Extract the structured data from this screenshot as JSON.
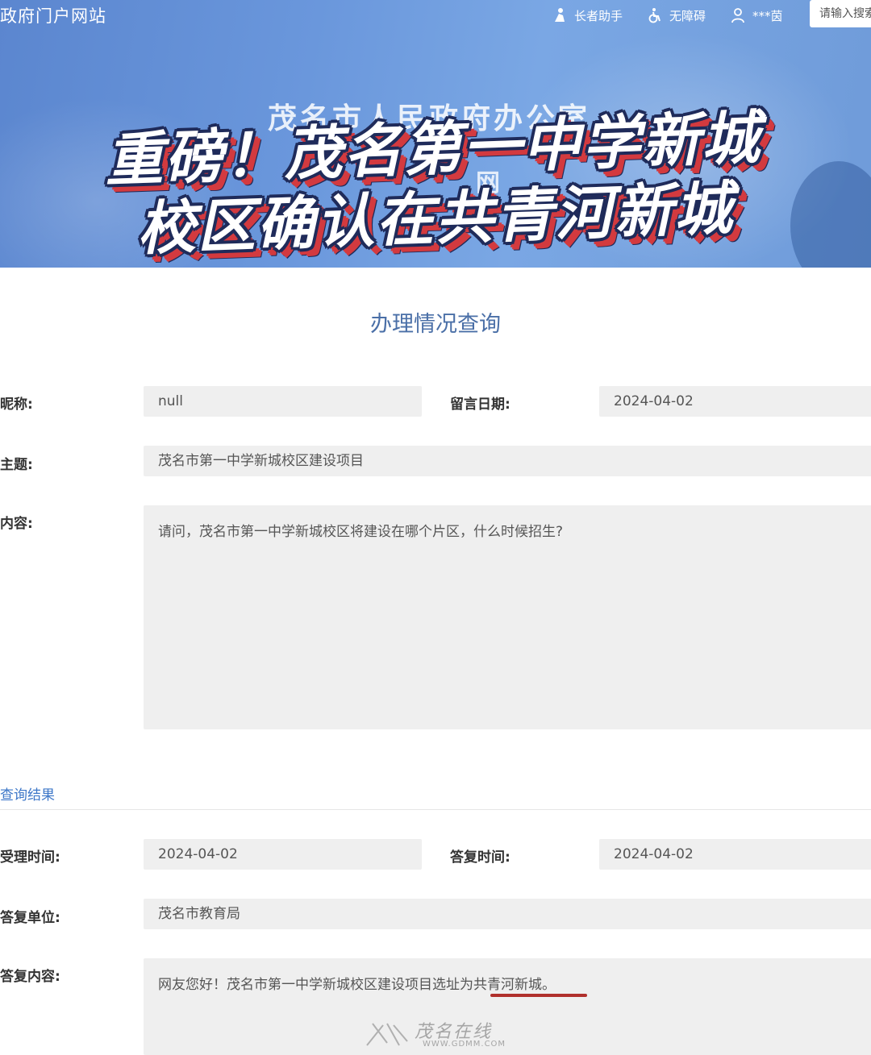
{
  "header": {
    "site_name": "政府门户网站",
    "nav": [
      {
        "label": "长者助手",
        "icon": "elder-assist-icon"
      },
      {
        "label": "无障碍",
        "icon": "accessibility-icon"
      },
      {
        "label": "***茵",
        "icon": "user-icon"
      }
    ],
    "search_placeholder": "请输入搜索",
    "org_title": "茂名市人民政府办公室",
    "org_subtitle": "网"
  },
  "headline": {
    "line1": "重磅！茂名第一中学新城",
    "line2": "校区确认在共青河新城"
  },
  "page_title": "办理情况查询",
  "form": {
    "nickname_label": "昵称:",
    "nickname_value": "null",
    "date_label": "留言日期:",
    "date_value": "2024-04-02",
    "subject_label": "主题:",
    "subject_value": "茂名市第一中学新城校区建设项目",
    "content_label": "内容:",
    "content_value": "请问，茂名市第一中学新城校区将建设在哪个片区，什么时候招生?"
  },
  "result": {
    "section_title": "查询结果",
    "accept_time_label": "受理时间:",
    "accept_time_value": "2024-04-02",
    "reply_time_label": "答复时间:",
    "reply_time_value": "2024-04-02",
    "reply_unit_label": "答复单位:",
    "reply_unit_value": "茂名市教育局",
    "reply_content_label": "答复内容:",
    "reply_content_value": "网友您好！茂名市第一中学新城校区建设项目选址为共青河新城。"
  },
  "watermark": {
    "text": "茂名在线",
    "url": "WWW.GDMM.COM"
  },
  "colors": {
    "banner": "#6a97dc",
    "page_title": "#4a6fa7",
    "section_title": "#3d77c8",
    "field_bg": "#efefef",
    "underline": "#b0302c",
    "headline_shadow": "#d33a3f"
  }
}
